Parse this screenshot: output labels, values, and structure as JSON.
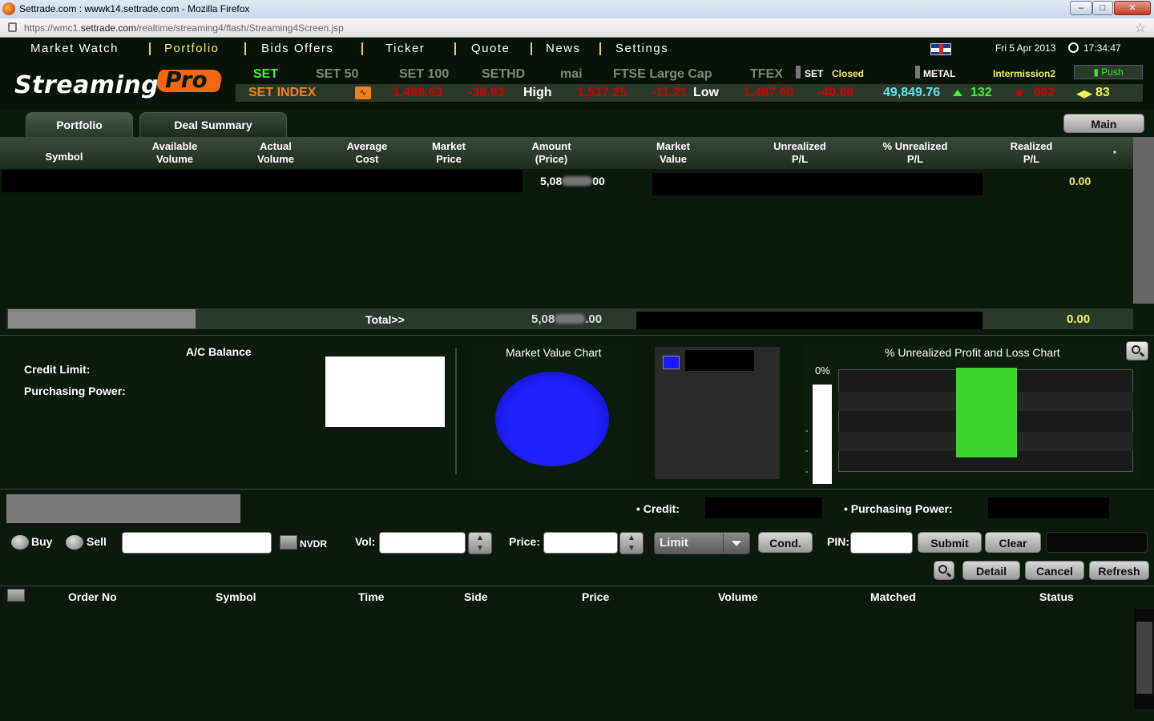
{
  "browser": {
    "window_title": "Settrade.com : wwwk14.settrade.com - Mozilla Firefox",
    "url_prefix": "https://wmc1.",
    "url_domain": "settrade.com",
    "url_path": "/realtime/streaming4/flash/Streaming4Screen.jsp"
  },
  "nav": {
    "items": [
      "Market Watch",
      "Portfolio",
      "Bids Offers",
      "Ticker",
      "Quote",
      "News",
      "Settings"
    ],
    "active": "Portfolio",
    "date": "Fri 5 Apr 2013",
    "time": "17:34:47"
  },
  "logo": {
    "text": "Streaming",
    "pro": "Pro"
  },
  "markets": {
    "tabs": [
      "SET",
      "SET 50",
      "SET 100",
      "SETHD",
      "mai",
      "FTSE Large Cap",
      "TFEX"
    ],
    "status_market": "SET",
    "status": "Closed",
    "metal": "METAL",
    "session": "Intermission2",
    "push_label": "Push"
  },
  "index": {
    "name": "SET INDEX",
    "last": "1,489.63",
    "change": "-38.93",
    "high_label": "High",
    "high": "1,517.25",
    "high_change": "-11.21",
    "low_label": "Low",
    "low": "1,487.60",
    "low_change": "-40.86",
    "volume": "49,849.76",
    "up": "132",
    "down": "662",
    "unchanged": "83"
  },
  "colors": {
    "accent_yellow": "#f0f060",
    "up_green": "#40f040",
    "down_red": "#d00000",
    "pl_bar": "#3dd42e",
    "pie_blue": "#1a1aff"
  },
  "tabs": {
    "portfolio": "Portfolio",
    "deal_summary": "Deal Summary",
    "main_button": "Main"
  },
  "portfolio_table": {
    "headers": [
      [
        "Symbol"
      ],
      [
        "Available",
        "Volume"
      ],
      [
        "Actual",
        "Volume"
      ],
      [
        "Average",
        "Cost"
      ],
      [
        "Market",
        "Price"
      ],
      [
        "Amount",
        "(Price)"
      ],
      [
        "Market",
        "Value"
      ],
      [
        "Unrealized",
        "P/L"
      ],
      [
        "% Unrealized",
        "P/L"
      ],
      [
        "Realized",
        "P/L"
      ],
      [
        "*"
      ]
    ],
    "row_amount_left": "5,08",
    "row_amount_right": "00",
    "row_realized": "0.00",
    "total_label": "Total>>",
    "total_amount_left": "5,08",
    "total_amount_right": ".00",
    "total_realized": "0.00"
  },
  "balance": {
    "title": "A/C Balance",
    "credit_limit": "Credit Limit:",
    "purchasing_power": "Purchasing Power:"
  },
  "charts": {
    "market_value_title": "Market Value Chart",
    "pl_title": "% Unrealized Profit and Loss Chart",
    "pl_axis_top": "0%"
  },
  "order": {
    "credit_label": "Credit:",
    "purchasing_power_label": "Purchasing Power:",
    "buy": "Buy",
    "sell": "Sell",
    "nvdr": "NVDR",
    "vol_label": "Vol:",
    "price_label": "Price:",
    "order_type": "Limit",
    "cond": "Cond.",
    "pin_label": "PIN:",
    "submit": "Submit",
    "clear": "Clear",
    "detail": "Detail",
    "cancel": "Cancel",
    "refresh": "Refresh",
    "headers": [
      "Order No",
      "Symbol",
      "Time",
      "Side",
      "Price",
      "Volume",
      "Matched",
      "Status"
    ]
  }
}
